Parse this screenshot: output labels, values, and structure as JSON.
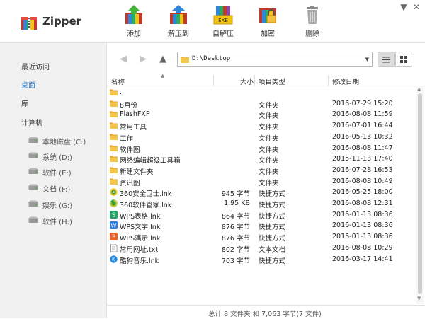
{
  "app": {
    "title": "Zipper"
  },
  "toolbar": [
    {
      "label": "添加",
      "icon": "add-archive-icon"
    },
    {
      "label": "解压到",
      "icon": "extract-to-icon"
    },
    {
      "label": "自解压",
      "icon": "self-extract-exe-icon"
    },
    {
      "label": "加密",
      "icon": "encrypt-lock-icon"
    },
    {
      "label": "删除",
      "icon": "trash-icon"
    }
  ],
  "window_controls": {
    "menu": "▼",
    "close": "✕"
  },
  "sidebar": {
    "items": [
      {
        "label": "最近访问",
        "active": false
      },
      {
        "label": "桌面",
        "active": true
      },
      {
        "label": "库",
        "active": false
      },
      {
        "label": "计算机",
        "active": false
      }
    ],
    "drives": [
      {
        "label": "本地磁盘 (C:)"
      },
      {
        "label": "系统 (D:)"
      },
      {
        "label": "软件 (E:)"
      },
      {
        "label": "文档 (F:)"
      },
      {
        "label": "娱乐 (G:)"
      },
      {
        "label": "软件 (H:)"
      }
    ]
  },
  "nav": {
    "back": "◀",
    "forward": "▶",
    "up": "▲"
  },
  "address": {
    "path": "D:\\Desktop"
  },
  "columns": {
    "name": "名称",
    "size": "大小",
    "type": "项目类型",
    "date": "修改日期"
  },
  "files": [
    {
      "name": "..",
      "size": "",
      "type": "",
      "date": "",
      "icon": "folder-icon"
    },
    {
      "name": "8月份",
      "size": "",
      "type": "文件夹",
      "date": "2016-07-29 15:20",
      "icon": "folder-icon"
    },
    {
      "name": "FlashFXP",
      "size": "",
      "type": "文件夹",
      "date": "2016-08-08 11:59",
      "icon": "folder-icon"
    },
    {
      "name": "常用工具",
      "size": "",
      "type": "文件夹",
      "date": "2016-07-01 16:44",
      "icon": "folder-icon"
    },
    {
      "name": "工作",
      "size": "",
      "type": "文件夹",
      "date": "2016-05-13 10:32",
      "icon": "folder-icon"
    },
    {
      "name": "软件图",
      "size": "",
      "type": "文件夹",
      "date": "2016-08-08 11:47",
      "icon": "folder-icon"
    },
    {
      "name": "网络编辑超级工具箱",
      "size": "",
      "type": "文件夹",
      "date": "2015-11-13 17:40",
      "icon": "folder-icon"
    },
    {
      "name": "新建文件夹",
      "size": "",
      "type": "文件夹",
      "date": "2016-07-28 16:53",
      "icon": "folder-icon"
    },
    {
      "name": "资讯图",
      "size": "",
      "type": "文件夹",
      "date": "2016-08-08 10:49",
      "icon": "folder-icon"
    },
    {
      "name": "360安全卫士.lnk",
      "size": "945 字节",
      "type": "快捷方式",
      "date": "2016-05-25 18:00",
      "icon": "360-security-icon"
    },
    {
      "name": "360软件管家.lnk",
      "size": "1.95 KB",
      "type": "快捷方式",
      "date": "2016-08-08 12:31",
      "icon": "360-software-icon"
    },
    {
      "name": "WPS表格.lnk",
      "size": "864 字节",
      "type": "快捷方式",
      "date": "2016-01-13 08:36",
      "icon": "wps-spreadsheet-icon"
    },
    {
      "name": "WPS文字.lnk",
      "size": "876 字节",
      "type": "快捷方式",
      "date": "2016-01-13 08:36",
      "icon": "wps-writer-icon"
    },
    {
      "name": "WPS演示.lnk",
      "size": "876 字节",
      "type": "快捷方式",
      "date": "2016-01-13 08:36",
      "icon": "wps-presentation-icon"
    },
    {
      "name": "常用网址.txt",
      "size": "802 字节",
      "type": "文本文档",
      "date": "2016-08-08 10:29",
      "icon": "text-file-icon"
    },
    {
      "name": "酷狗音乐.lnk",
      "size": "703 字节",
      "type": "快捷方式",
      "date": "2016-03-17 14:41",
      "icon": "kugou-music-icon"
    }
  ],
  "status": "总计 8 文件夹 和  7,063 字节(7 文件)",
  "colors": {
    "accent": "#2a7fd4",
    "sidebar_bg": "#f1f1f1",
    "folder": "#f0b93a"
  }
}
